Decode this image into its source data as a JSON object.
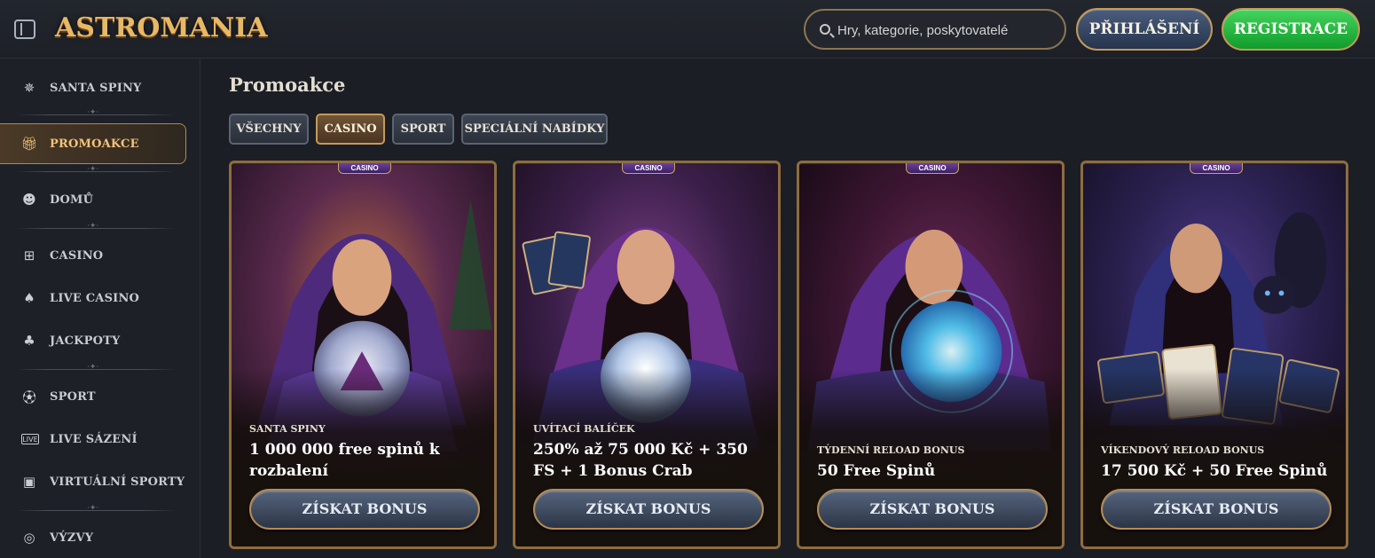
{
  "header": {
    "logo": "ASTROMANIA",
    "search_placeholder": "Hry, kategorie, poskytovatelé",
    "login_label": "PŘIHLÁŠENÍ",
    "register_label": "REGISTRACE"
  },
  "sidebar": {
    "items": [
      {
        "label": "SANTA SPINY",
        "icon": "santa-spins-icon"
      },
      {
        "label": "PROMOAKCE",
        "icon": "gift-icon",
        "active": true
      },
      {
        "label": "DOMŮ",
        "icon": "home-icon"
      },
      {
        "label": "CASINO",
        "icon": "slot-machine-icon"
      },
      {
        "label": "LIVE CASINO",
        "icon": "cards-icon"
      },
      {
        "label": "JACKPOTY",
        "icon": "clover-icon"
      },
      {
        "label": "SPORT",
        "icon": "soccer-ball-icon"
      },
      {
        "label": "LIVE SÁZENÍ",
        "icon": "live-icon"
      },
      {
        "label": "VIRTUÁLNÍ SPORTY",
        "icon": "virtual-screen-icon"
      },
      {
        "label": "VÝZVY",
        "icon": "target-icon"
      }
    ]
  },
  "main": {
    "title": "Promoakce",
    "tabs": [
      {
        "label": "VŠECHNY"
      },
      {
        "label": "CASINO",
        "active": true
      },
      {
        "label": "SPORT"
      },
      {
        "label": "SPECIÁLNÍ NABÍDKY"
      }
    ],
    "cards": [
      {
        "tag": "CASINO",
        "subtitle": "SANTA SPINY",
        "headline": "1 000 000 free spinů k rozbalení",
        "cta": "ZÍSKAT BONUS",
        "accent": "#7b3fa8"
      },
      {
        "tag": "CASINO",
        "subtitle": "UVÍTACÍ BALÍČEK",
        "headline": "250% až 75 000 Kč + 350 FS + 1 Bonus Crab",
        "cta": "ZÍSKAT BONUS",
        "accent": "#8a2e58"
      },
      {
        "tag": "CASINO",
        "subtitle": "TÝDENNÍ RELOAD BONUS",
        "headline": "50 Free Spinů",
        "cta": "ZÍSKAT BONUS",
        "accent": "#2c4fa0"
      },
      {
        "tag": "CASINO",
        "subtitle": "VÍKENDOVÝ RELOAD BONUS",
        "headline": "17 500 Kč + 50 Free Spinů",
        "cta": "ZÍSKAT BONUS",
        "accent": "#2a3f8e"
      }
    ]
  }
}
